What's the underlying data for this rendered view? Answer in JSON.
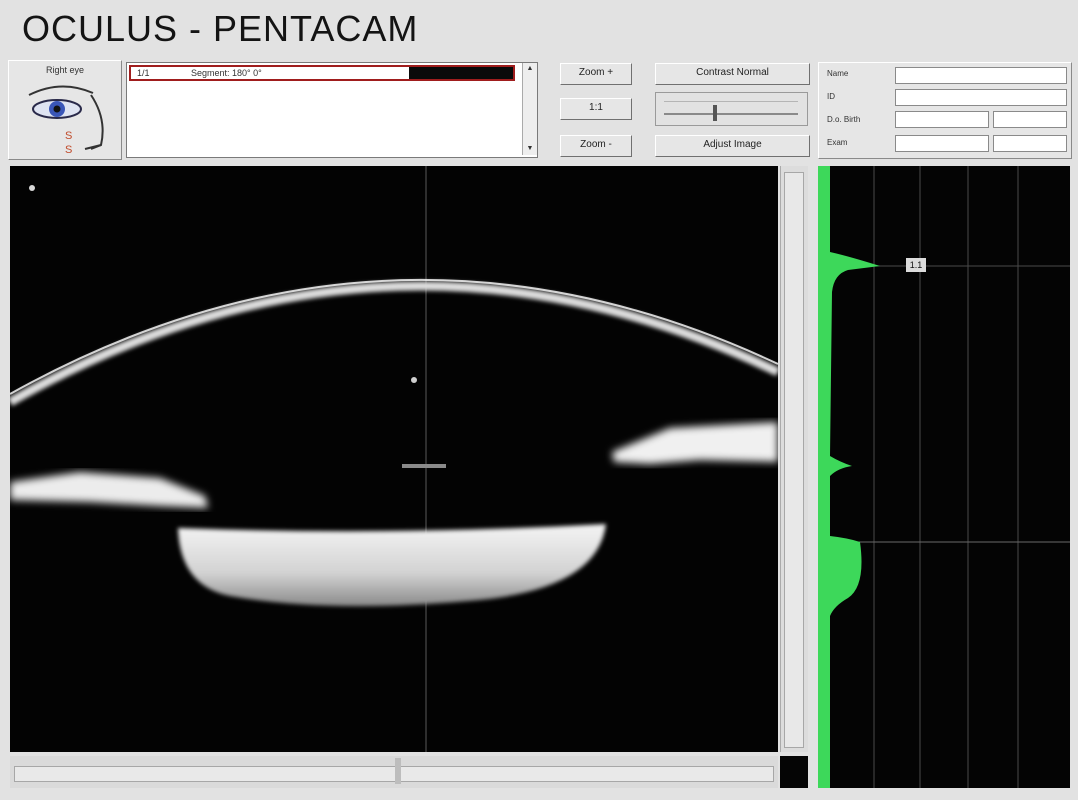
{
  "app": {
    "title": "OCULUS  -  PENTACAM"
  },
  "eye_selector": {
    "label": "Right eye"
  },
  "scan_list": {
    "rows": [
      {
        "index": "1/1",
        "segment": "Segment: 180° 0°"
      }
    ]
  },
  "zoom": {
    "zoom_in_label": "Zoom +",
    "one_to_one_label": "1:1",
    "zoom_out_label": "Zoom -"
  },
  "image_controls": {
    "contrast_label": "Contrast Normal",
    "adjust_label": "Adjust Image",
    "contrast_level": 0.38
  },
  "patient": {
    "name_label": "Name",
    "id_label": "ID",
    "dob_label": "D.o. Birth",
    "exam_label": "Exam"
  },
  "densitometry": {
    "marker_label": "1.1"
  },
  "colors": {
    "accent_green": "#3dd85a",
    "selection_red": "#a01d1d",
    "background": "#e2e2e2"
  }
}
